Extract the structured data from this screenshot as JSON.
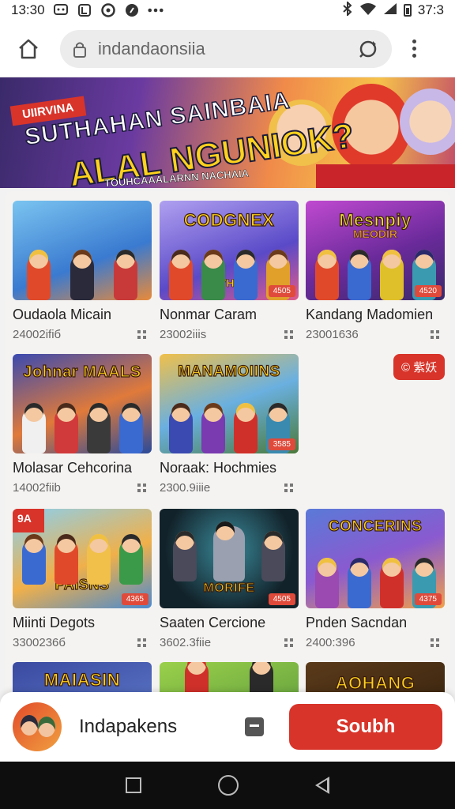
{
  "status_bar": {
    "time": "13:30",
    "battery": "37:3"
  },
  "browser": {
    "url": "indandaonsiia"
  },
  "banner": {
    "ribbon": "UIIRVINA",
    "headline_line1": "SUTHAHAN SAINBAIA",
    "headline_line2": "ALAL NGUNIOK?",
    "subline": "TOUHCAAALARNN NACHAIA"
  },
  "floating_badge": "© 紫妖",
  "games": [
    {
      "title": "Oudaola Micain",
      "meta": "24002ifiб",
      "logo": "",
      "logo2": "",
      "badge": "",
      "bg": "#5fa8e8"
    },
    {
      "title": "Nonmar Caram",
      "meta": "23002iiis",
      "logo": "CODGNEX",
      "logo2": "OIIIVHENS",
      "badge": "4505",
      "bg": "#7a6ad8"
    },
    {
      "title": "Kandang Madomien",
      "meta": "23001636",
      "logo": "Mesnpiy",
      "logo2": "MEODIR",
      "badge": "4520",
      "bg": "#a04ab0"
    },
    {
      "title": "Molasar Cehcorina",
      "meta": "14002fiib",
      "logo": "Johnar MAALS",
      "logo2": "",
      "badge": "",
      "bg": "#3a6ac0"
    },
    {
      "title": "Noraak: Hochmies",
      "meta": "2300.9iiie",
      "logo": "MANAMOIINS",
      "logo2": "",
      "badge": "3585",
      "bg": "#e09a3a"
    },
    {
      "title": "Miinti Degots",
      "meta": "3300236б",
      "logo": "PAISNS",
      "logo2": "",
      "badge": "4365",
      "bg": "#6ab0e0"
    },
    {
      "title": "Saaten Cercione",
      "meta": "3602.3fiie",
      "logo": "MORIFE",
      "logo2": "",
      "badge": "4505",
      "bg": "#1a3a4a"
    },
    {
      "title": "Pnden Sacndan",
      "meta": "2400:396",
      "logo": "CONCERINS",
      "logo2": "",
      "badge": "4375",
      "bg": "#5a6ad0"
    },
    {
      "title": "",
      "meta": "",
      "logo": "MAIASIN",
      "logo2": "",
      "badge": "",
      "bg": "#3a4aa0"
    },
    {
      "title": "",
      "meta": "",
      "logo": "",
      "logo2": "",
      "badge": "",
      "bg": "#6aa04a"
    },
    {
      "title": "",
      "meta": "",
      "logo": "AOHANG",
      "logo2": "",
      "badge": "",
      "bg": "#4a2a1a"
    }
  ],
  "action_bar": {
    "account_name": "Indapakens",
    "cta_label": "Soubh"
  },
  "colors": {
    "accent": "#d8342a"
  }
}
